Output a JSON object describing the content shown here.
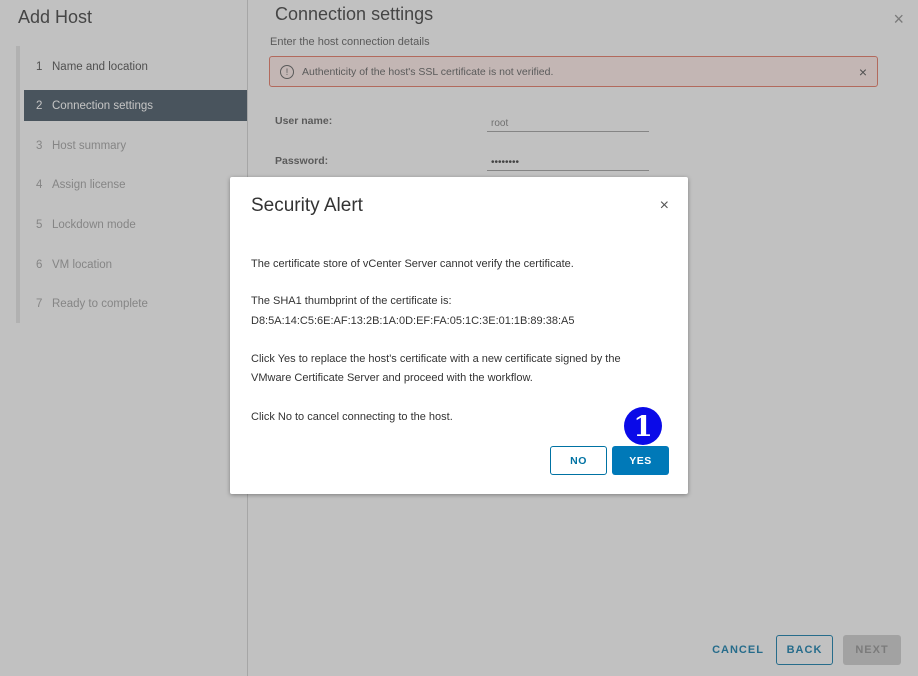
{
  "wizard": {
    "title": "Add Host",
    "steps": [
      {
        "num": "1",
        "label": "Name and location"
      },
      {
        "num": "2",
        "label": "Connection settings"
      },
      {
        "num": "3",
        "label": "Host summary"
      },
      {
        "num": "4",
        "label": "Assign license"
      },
      {
        "num": "5",
        "label": "Lockdown mode"
      },
      {
        "num": "6",
        "label": "VM location"
      },
      {
        "num": "7",
        "label": "Ready to complete"
      }
    ]
  },
  "main": {
    "title": "Connection settings",
    "close_icon": "×",
    "subtitle": "Enter the host connection details",
    "alert": {
      "icon": "!",
      "text": "Authenticity of the host's SSL certificate is not verified.",
      "close_icon": "×"
    },
    "fields": {
      "username_label": "User name:",
      "username_value": "root",
      "password_label": "Password:",
      "password_value": "••••••••"
    }
  },
  "footer": {
    "cancel": "CANCEL",
    "back": "BACK",
    "next": "NEXT"
  },
  "dialog": {
    "title": "Security Alert",
    "close_icon": "×",
    "line1": "The certificate store of vCenter Server cannot verify the certificate.",
    "line2": "The SHA1 thumbprint of the certificate is:",
    "thumbprint": "D8:5A:14:C5:6E:AF:13:2B:1A:0D:EF:FA:05:1C:3E:01:1B:89:38:A5",
    "line3a": "Click Yes to replace the host's certificate with a new certificate signed by the",
    "line3b": "VMware Certificate Server and proceed with the workflow.",
    "line4": "Click No to cancel connecting to the host.",
    "no": "NO",
    "yes": "YES"
  },
  "marker": "1",
  "colors": {
    "accent": "#0079b8",
    "active_step": "#394b59",
    "alert_border": "#e36f5a",
    "marker": "#0a0ae8"
  }
}
